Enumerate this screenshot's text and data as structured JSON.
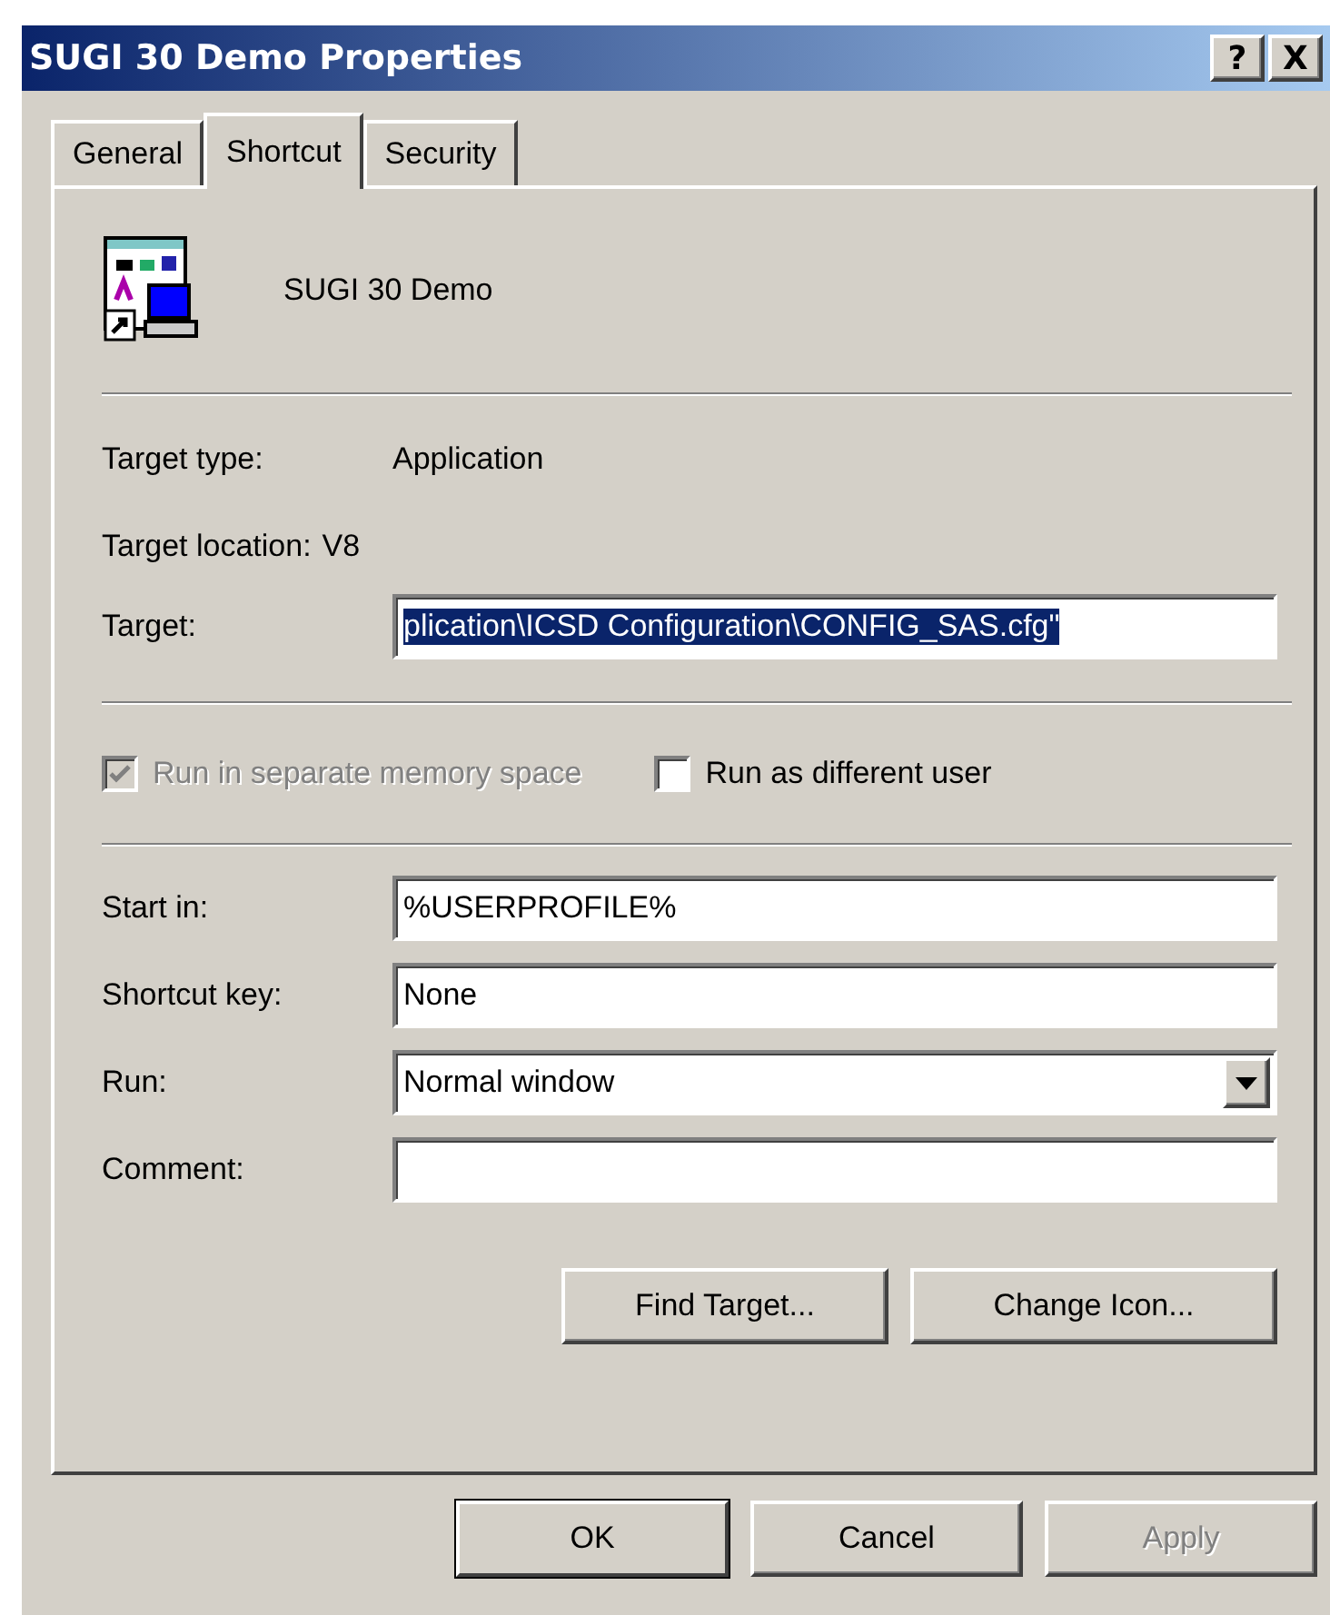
{
  "window": {
    "title": "SUGI 30 Demo Properties",
    "controls": [
      "?",
      "X"
    ]
  },
  "tabs": [
    {
      "label": "General",
      "selected": false
    },
    {
      "label": "Shortcut",
      "selected": true
    },
    {
      "label": "Security",
      "selected": false
    }
  ],
  "shortcut_name": "SUGI 30 Demo",
  "info": [
    {
      "label": "Target type:",
      "value": "Application"
    },
    {
      "label": "Target location:",
      "value": "V8"
    }
  ],
  "target": {
    "label": "Target:",
    "value": "plication\\ICSD Configuration\\CONFIG_SAS.cfg\"",
    "selected": true
  },
  "options": [
    {
      "label": "Run in separate memory space",
      "checked": true,
      "disabled": true
    },
    {
      "label": "Run as different user",
      "checked": false,
      "disabled": false
    }
  ],
  "fields": [
    {
      "kind": "input",
      "label": "Start in:",
      "value": "%USERPROFILE%"
    },
    {
      "kind": "input",
      "label": "Shortcut key:",
      "value": "None"
    },
    {
      "kind": "select",
      "label": "Run:",
      "value": "Normal window"
    },
    {
      "kind": "input",
      "label": "Comment:"
    }
  ],
  "actions": [
    "Find Target...",
    "Change Icon..."
  ],
  "buttons": [
    {
      "label": "OK",
      "default": true,
      "disabled": false
    },
    {
      "label": "Cancel",
      "default": false,
      "disabled": false
    },
    {
      "label": "Apply",
      "default": false,
      "disabled": true
    }
  ]
}
